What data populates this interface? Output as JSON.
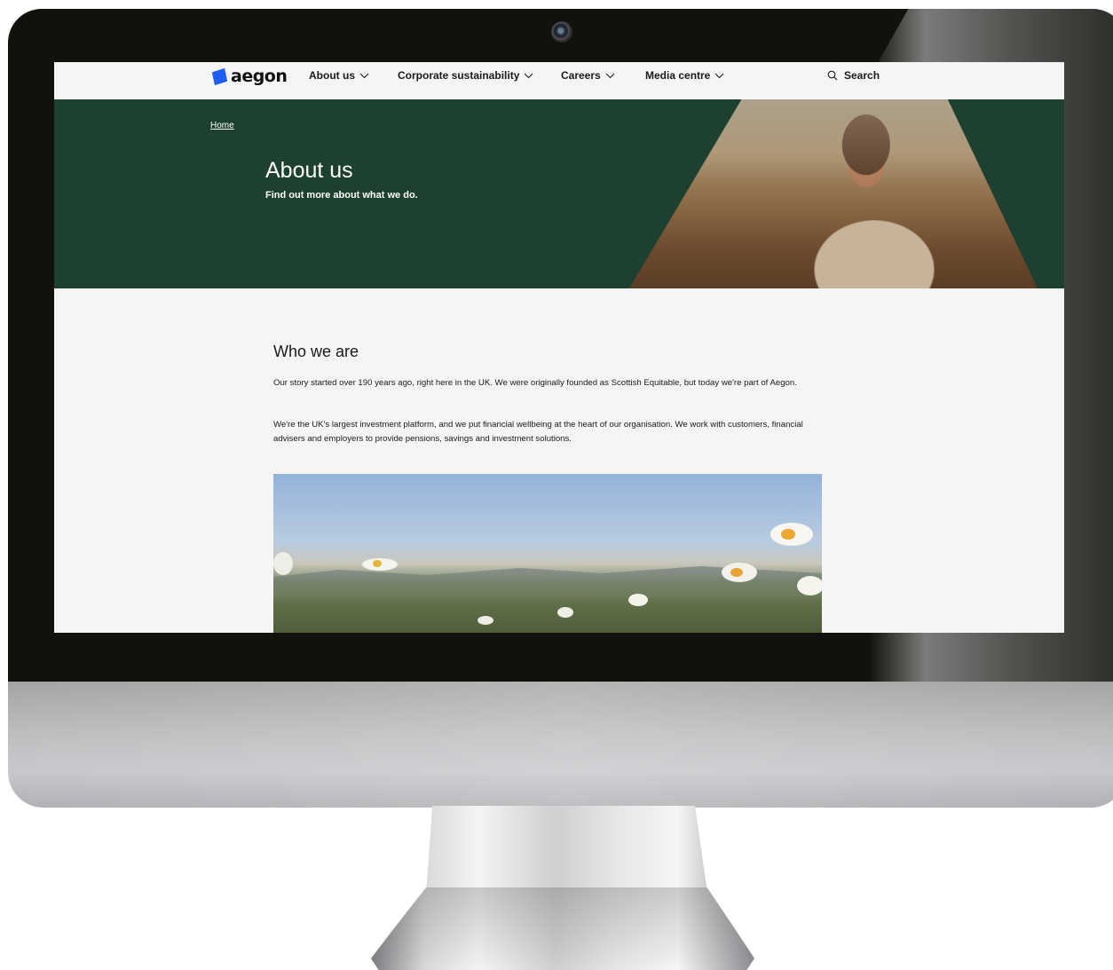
{
  "brand": {
    "name": "aegon",
    "accent": "#1f5ef5",
    "hero_bg": "#1d4030"
  },
  "nav": {
    "items": [
      {
        "label": "About us"
      },
      {
        "label": "Corporate sustainability"
      },
      {
        "label": "Careers"
      },
      {
        "label": "Media centre"
      }
    ],
    "search_label": "Search"
  },
  "hero": {
    "breadcrumb": "Home",
    "title": "About us",
    "subtitle": "Find out more about what we do."
  },
  "main": {
    "section_title": "Who we are",
    "paragraphs": [
      "Our story started over 190 years ago, right here in the UK. We were originally founded as Scottish Equitable, but today we're part of Aegon.",
      "We're the UK's largest investment platform, and we put financial wellbeing at the heart of our organisation. We work with customers, financial advisers and employers to provide pensions, savings and investment solutions."
    ]
  },
  "icons": {
    "search": "search-icon",
    "chevron": "chevron-down-icon",
    "camera": "camera-icon"
  }
}
